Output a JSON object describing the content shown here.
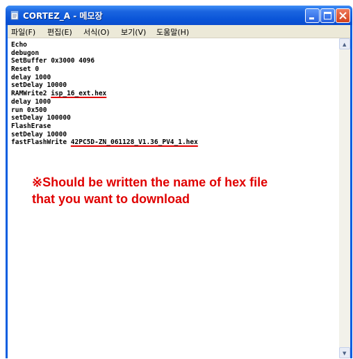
{
  "window": {
    "title": "CORTEZ_A - 메모장",
    "app_icon": "notepad-icon",
    "controls": [
      "minimize-icon",
      "maximize-icon",
      "close-icon"
    ]
  },
  "menu": {
    "items": [
      {
        "label": "파일(F)"
      },
      {
        "label": "편집(E)"
      },
      {
        "label": "서식(O)"
      },
      {
        "label": "보기(V)"
      },
      {
        "label": "도움말(H)"
      }
    ]
  },
  "editor": {
    "lines": [
      {
        "prefix": "Echo",
        "hex": ""
      },
      {
        "prefix": "debugon",
        "hex": ""
      },
      {
        "prefix": "SetBuffer 0x3000 4096",
        "hex": ""
      },
      {
        "prefix": "Reset 0",
        "hex": ""
      },
      {
        "prefix": "delay 1000",
        "hex": ""
      },
      {
        "prefix": "setDelay 10000",
        "hex": ""
      },
      {
        "prefix": "RAMWrite2 ",
        "hex": "isp_16_ext.hex"
      },
      {
        "prefix": "delay 1000",
        "hex": ""
      },
      {
        "prefix": "run 0x500",
        "hex": ""
      },
      {
        "prefix": "setDelay 100000",
        "hex": ""
      },
      {
        "prefix": "FlashErase",
        "hex": ""
      },
      {
        "prefix": "setDelay 10000",
        "hex": ""
      },
      {
        "prefix": "fastFlashWrite ",
        "hex": "42PC5D-ZN_061128_V1.36_PV4_1.hex"
      }
    ],
    "annotation": {
      "line1": "※Should be written the name of hex file",
      "line2": "that you want to download",
      "color": "#e00000"
    }
  },
  "colors": {
    "titlebar": "#0a55d8",
    "menubar": "#ece9d8",
    "annotation": "#e00000"
  }
}
